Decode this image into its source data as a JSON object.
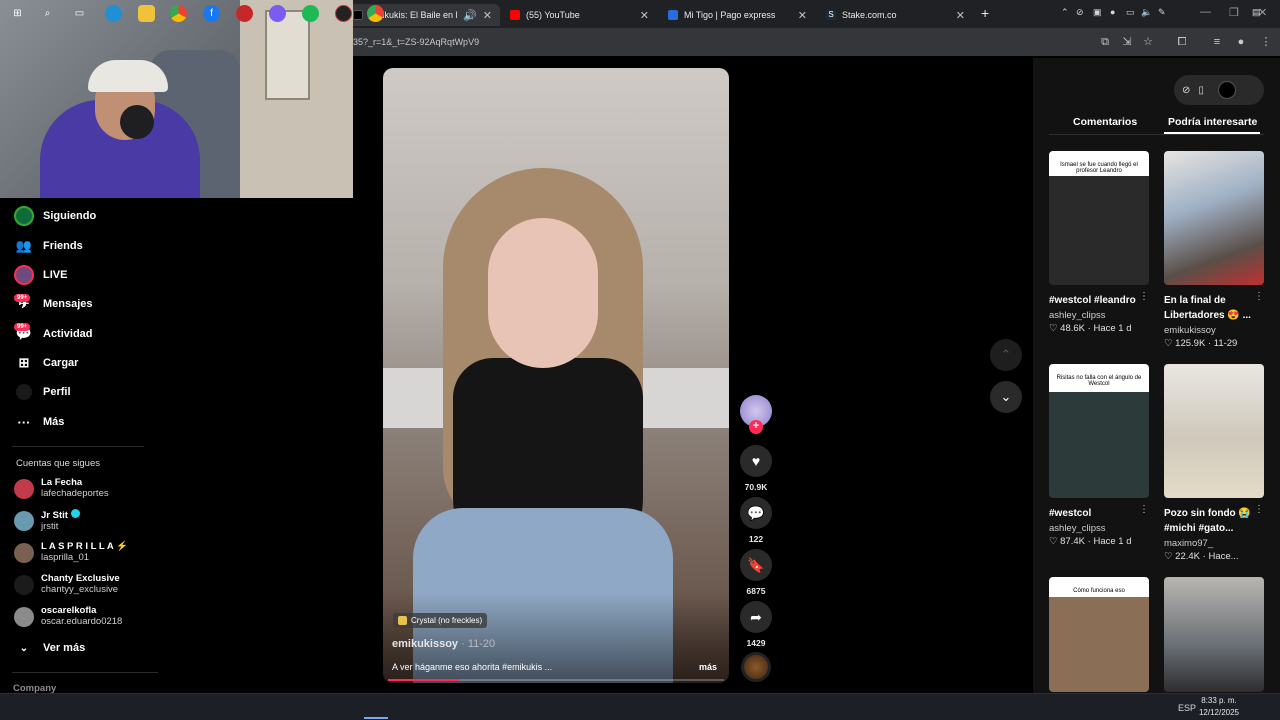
{
  "browser": {
    "tabs": [
      {
        "label": "Emikukis: El Baile en la Disco",
        "active": true,
        "audio_icon": "speaker-icon"
      },
      {
        "label": "(55) YouTube",
        "active": false
      },
      {
        "label": "Mi Tigo | Pago express",
        "active": false
      },
      {
        "label": "Stake.com.co",
        "active": false
      }
    ],
    "new_tab": "+",
    "url": "35?_r=1&_t=ZS-92AqRqtWpV9"
  },
  "nav": {
    "items": [
      {
        "label": "Siguiendo",
        "icon": "following-avatar-icon"
      },
      {
        "label": "Friends",
        "icon": "friends-icon"
      },
      {
        "label": "LIVE",
        "icon": "live-icon"
      },
      {
        "label": "Mensajes",
        "icon": "messages-icon",
        "badge": "99+"
      },
      {
        "label": "Actividad",
        "icon": "activity-icon",
        "badge": "99+"
      },
      {
        "label": "Cargar",
        "icon": "upload-icon"
      },
      {
        "label": "Perfil",
        "icon": "profile-icon"
      },
      {
        "label": "Más",
        "icon": "more-icon"
      }
    ],
    "following_title": "Cuentas que sigues",
    "accounts": [
      {
        "name": "La Fecha",
        "handle": "lafechadeportes"
      },
      {
        "name": "Jr Stit",
        "handle": "jrstit",
        "verified": true
      },
      {
        "name": "L A S P R I L L A ⚡",
        "handle": "lasprilla_01"
      },
      {
        "name": "Chanty Exclusive",
        "handle": "chantyy_exclusive"
      },
      {
        "name": "oscarelkofla",
        "handle": "oscar.eduardo0218"
      }
    ],
    "see_more": "Ver más",
    "company": "Company"
  },
  "video": {
    "sound_tag": "Crystal (no freckles)",
    "author": "emikukissoy",
    "date": " · 11-20",
    "caption": "A ver háganme eso ahorita #emikukis ...",
    "more": "más",
    "progress": 0.21
  },
  "actions": {
    "likes": "70.9K",
    "comments": "122",
    "saves": "6875",
    "shares": "1429"
  },
  "panel": {
    "tab_comments": "Comentarios",
    "tab_suggested": "Podría interesarte",
    "cards": [
      {
        "caption": "Ismael se fue cuando llegó el profesor Leandro",
        "title": "#westcol #leandro",
        "author": "ashley_clipss",
        "likes": "48.6K",
        "when": "Hace 1 d"
      },
      {
        "caption": "",
        "title": "En la final de Libertadores 😍 ...",
        "author": "emikukissoy",
        "likes": "125.9K",
        "when": "11-29"
      },
      {
        "caption": "Risitas no falla con el ángulo de Westcol",
        "title": "#westcol",
        "author": "ashley_clipss",
        "likes": "87.4K",
        "when": "Hace 1 d"
      },
      {
        "caption": "",
        "title": "Pozo sin fondo 😭 #michi #gato...",
        "author": "maximo97_",
        "likes": "22.4K",
        "when": "Hace..."
      },
      {
        "caption": "Cómo funciona eso",
        "title": "",
        "author": "",
        "likes": "",
        "when": ""
      },
      {
        "caption": "",
        "title": "",
        "author": "",
        "likes": "",
        "when": ""
      }
    ]
  },
  "taskbar": {
    "lang": "ESP",
    "time": "8:33 p. m.",
    "date": "12/12/2025"
  },
  "colors": {
    "accent": "#fe2c55",
    "panel_bg": "#121212",
    "chrome": "#35363a"
  }
}
